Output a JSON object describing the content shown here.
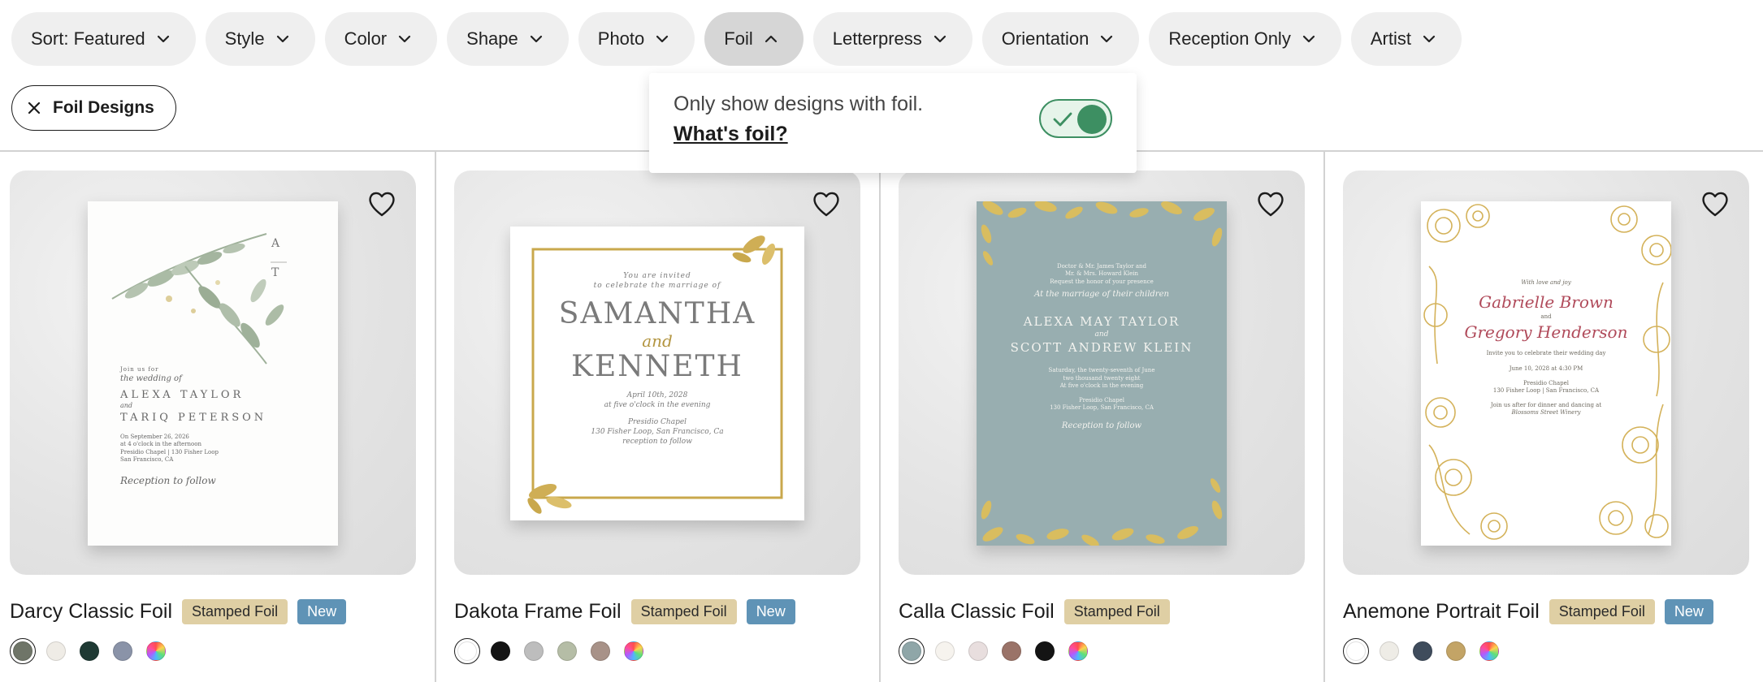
{
  "filters": [
    {
      "label": "Sort: Featured",
      "name": "filter-sort",
      "active": false
    },
    {
      "label": "Style",
      "name": "filter-style",
      "active": false
    },
    {
      "label": "Color",
      "name": "filter-color",
      "active": false
    },
    {
      "label": "Shape",
      "name": "filter-shape",
      "active": false
    },
    {
      "label": "Photo",
      "name": "filter-photo",
      "active": false
    },
    {
      "label": "Foil",
      "name": "filter-foil",
      "active": true
    },
    {
      "label": "Letterpress",
      "name": "filter-letterpress",
      "active": false
    },
    {
      "label": "Orientation",
      "name": "filter-orientation",
      "active": false
    },
    {
      "label": "Reception Only",
      "name": "filter-reception-only",
      "active": false
    },
    {
      "label": "Artist",
      "name": "filter-artist",
      "active": false
    }
  ],
  "applied_filter": {
    "label": "Foil Designs",
    "icon": "close-icon"
  },
  "popover": {
    "text": "Only show designs with foil.",
    "link": "What's foil?",
    "toggle_on": true,
    "toggle_color": "#3d8f62"
  },
  "products": [
    {
      "title": "Darcy Classic Foil",
      "badge_foil": "Stamped Foil",
      "badge_new": "New",
      "invite": {
        "intro": "Join us for",
        "line2": "the wedding of",
        "name1": "ALEXA TAYLOR",
        "amp": "and",
        "name2": "TARIQ PETERSON",
        "date": "On September 26, 2026",
        "time": "at 4 o'clock in the afternoon",
        "venue": "Presidio Chapel | 130 Fisher Loop",
        "city": "San Francisco, CA",
        "footer": "Reception to follow",
        "mono_top": "A",
        "mono_bottom": "T"
      },
      "swatches": [
        "#6f7568",
        "#efece6",
        "#1f3a34",
        "#8a93a8",
        "rainbow"
      ],
      "selected_swatch": 0
    },
    {
      "title": "Dakota Frame Foil",
      "badge_foil": "Stamped Foil",
      "badge_new": "New",
      "invite": {
        "intro": "You are invited",
        "line2": "to celebrate the marriage of",
        "name1": "SAMANTHA",
        "amp": "and",
        "name2": "KENNETH",
        "date": "April 10th, 2028",
        "time": "at five o'clock in the evening",
        "venue": "Presidio Chapel",
        "city": "130 Fisher Loop, San Francisco, Ca",
        "footer": "reception to follow"
      },
      "swatches": [
        "#ffffff",
        "#141414",
        "#bdbdbd",
        "#b5bda6",
        "#a89288",
        "rainbow"
      ],
      "selected_swatch": 0
    },
    {
      "title": "Calla Classic Foil",
      "badge_foil": "Stamped Foil",
      "invite": {
        "intro": "Doctor & Mr. James Taylor and",
        "line2": "Mr. & Mrs. Howard Klein",
        "line3": "Request the honor of your presence",
        "line4": "At the marriage of their children",
        "name1": "ALEXA MAY TAYLOR",
        "amp": "and",
        "name2": "SCOTT ANDREW KLEIN",
        "date": "Saturday, the twenty-seventh of June",
        "year": "two thousand twenty eight",
        "time": "At five o'clock in the evening",
        "venue": "Presidio Chapel",
        "city": "130 Fisher Loop, San Francisco, CA",
        "footer": "Reception to follow"
      },
      "swatches": [
        "#8fa6a8",
        "#f6f3ee",
        "#e8dede",
        "#9a7368",
        "#141414",
        "rainbow"
      ],
      "selected_swatch": 0
    },
    {
      "title": "Anemone Portrait Foil",
      "badge_foil": "Stamped Foil",
      "badge_new": "New",
      "invite": {
        "intro": "With love and joy",
        "name1": "Gabrielle Brown",
        "amp": "and",
        "name2": "Gregory Henderson",
        "line2": "Invite you to celebrate their wedding day",
        "date": "June 10, 2028 at 4:30 PM",
        "venue": "Presidio Chapel",
        "city": "130 Fisher Loop | San Francisco, CA",
        "line3": "Join us after for dinner and dancing at",
        "footer": "Blossoms Street Winery"
      },
      "swatches": [
        "#ffffff",
        "#eeece6",
        "#3f4c5c",
        "#c3a466",
        "rainbow"
      ],
      "selected_swatch": 0
    }
  ]
}
